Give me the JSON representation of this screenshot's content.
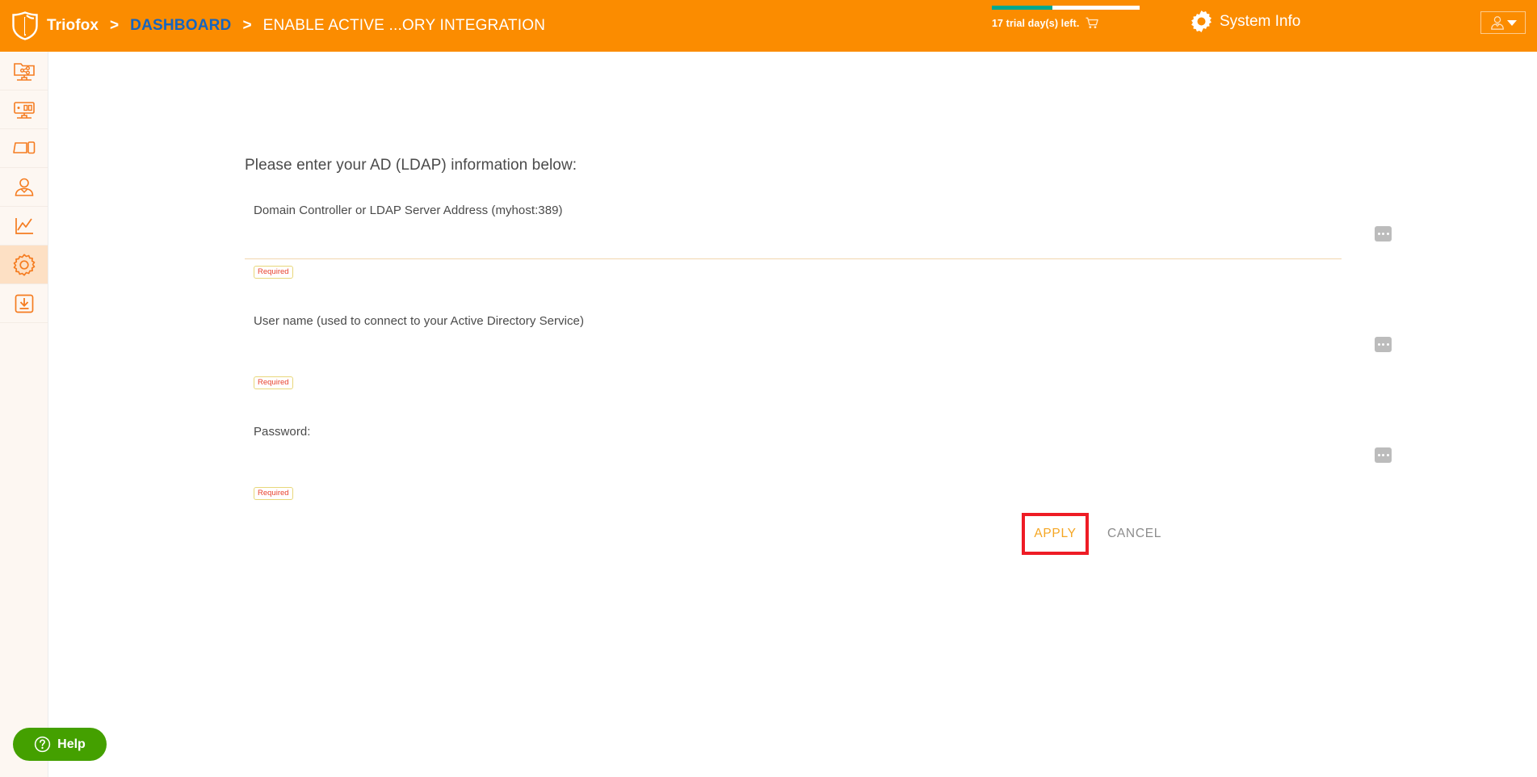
{
  "topbar": {
    "logo_icon": "shield-logo-icon",
    "brand": "Triofox",
    "separator": ">",
    "breadcrumb_dashboard": "DASHBOARD",
    "breadcrumb_current": "ENABLE ACTIVE ...ORY INTEGRATION",
    "trial_text": "17 trial day(s) left.",
    "trial_progress_percent": 41,
    "trial_bar_fill_color": "#00a88e",
    "trial_bar_track_color": "#ffffff",
    "cart_icon": "shopping-cart-icon",
    "system_info_label": "System Info",
    "system_info_icon": "gear-icon",
    "user_icon": "user-avatar-icon",
    "user_caret_icon": "chevron-down-icon",
    "background_color": "#fb8c00"
  },
  "sidebar": {
    "background_color": "#fdf7f2",
    "active_background_color": "#fde0c4",
    "accent_color": "#f57c20",
    "items": [
      {
        "name": "shared-folder-network-icon",
        "label": "Shared Folders",
        "active": false
      },
      {
        "name": "server-monitor-icon",
        "label": "Servers",
        "active": false
      },
      {
        "name": "devices-icon",
        "label": "Devices",
        "active": false
      },
      {
        "name": "user-icon",
        "label": "Users",
        "active": false
      },
      {
        "name": "reports-chart-icon",
        "label": "Reports",
        "active": false
      },
      {
        "name": "gear-settings-icon",
        "label": "Settings",
        "active": true
      },
      {
        "name": "download-box-icon",
        "label": "Downloads",
        "active": false
      }
    ]
  },
  "main": {
    "intro": "Please enter your AD (LDAP) information below:",
    "fields": [
      {
        "label": "Domain Controller or LDAP Server Address (myhost:389)",
        "value": "",
        "placeholder": "",
        "validation": "Required",
        "browse_icon": "ellipsis-icon",
        "has_underline": true
      },
      {
        "label": "User name (used to connect to your Active Directory Service)",
        "value": "",
        "placeholder": "",
        "validation": "Required",
        "browse_icon": "ellipsis-icon",
        "has_underline": false
      },
      {
        "label": "Password:",
        "value": "",
        "placeholder": "",
        "validation": "Required",
        "browse_icon": "ellipsis-icon",
        "has_underline": false
      }
    ],
    "apply_label": "APPLY",
    "cancel_label": "CANCEL",
    "apply_color": "#f5a623",
    "cancel_color": "#8c8c8c",
    "highlight_color": "#ee1c25",
    "required_text_color": "#e8422f",
    "required_border_color": "#e8d77a"
  },
  "help": {
    "label": "Help",
    "icon": "question-mark-circle-icon",
    "background_color": "#44a000"
  }
}
